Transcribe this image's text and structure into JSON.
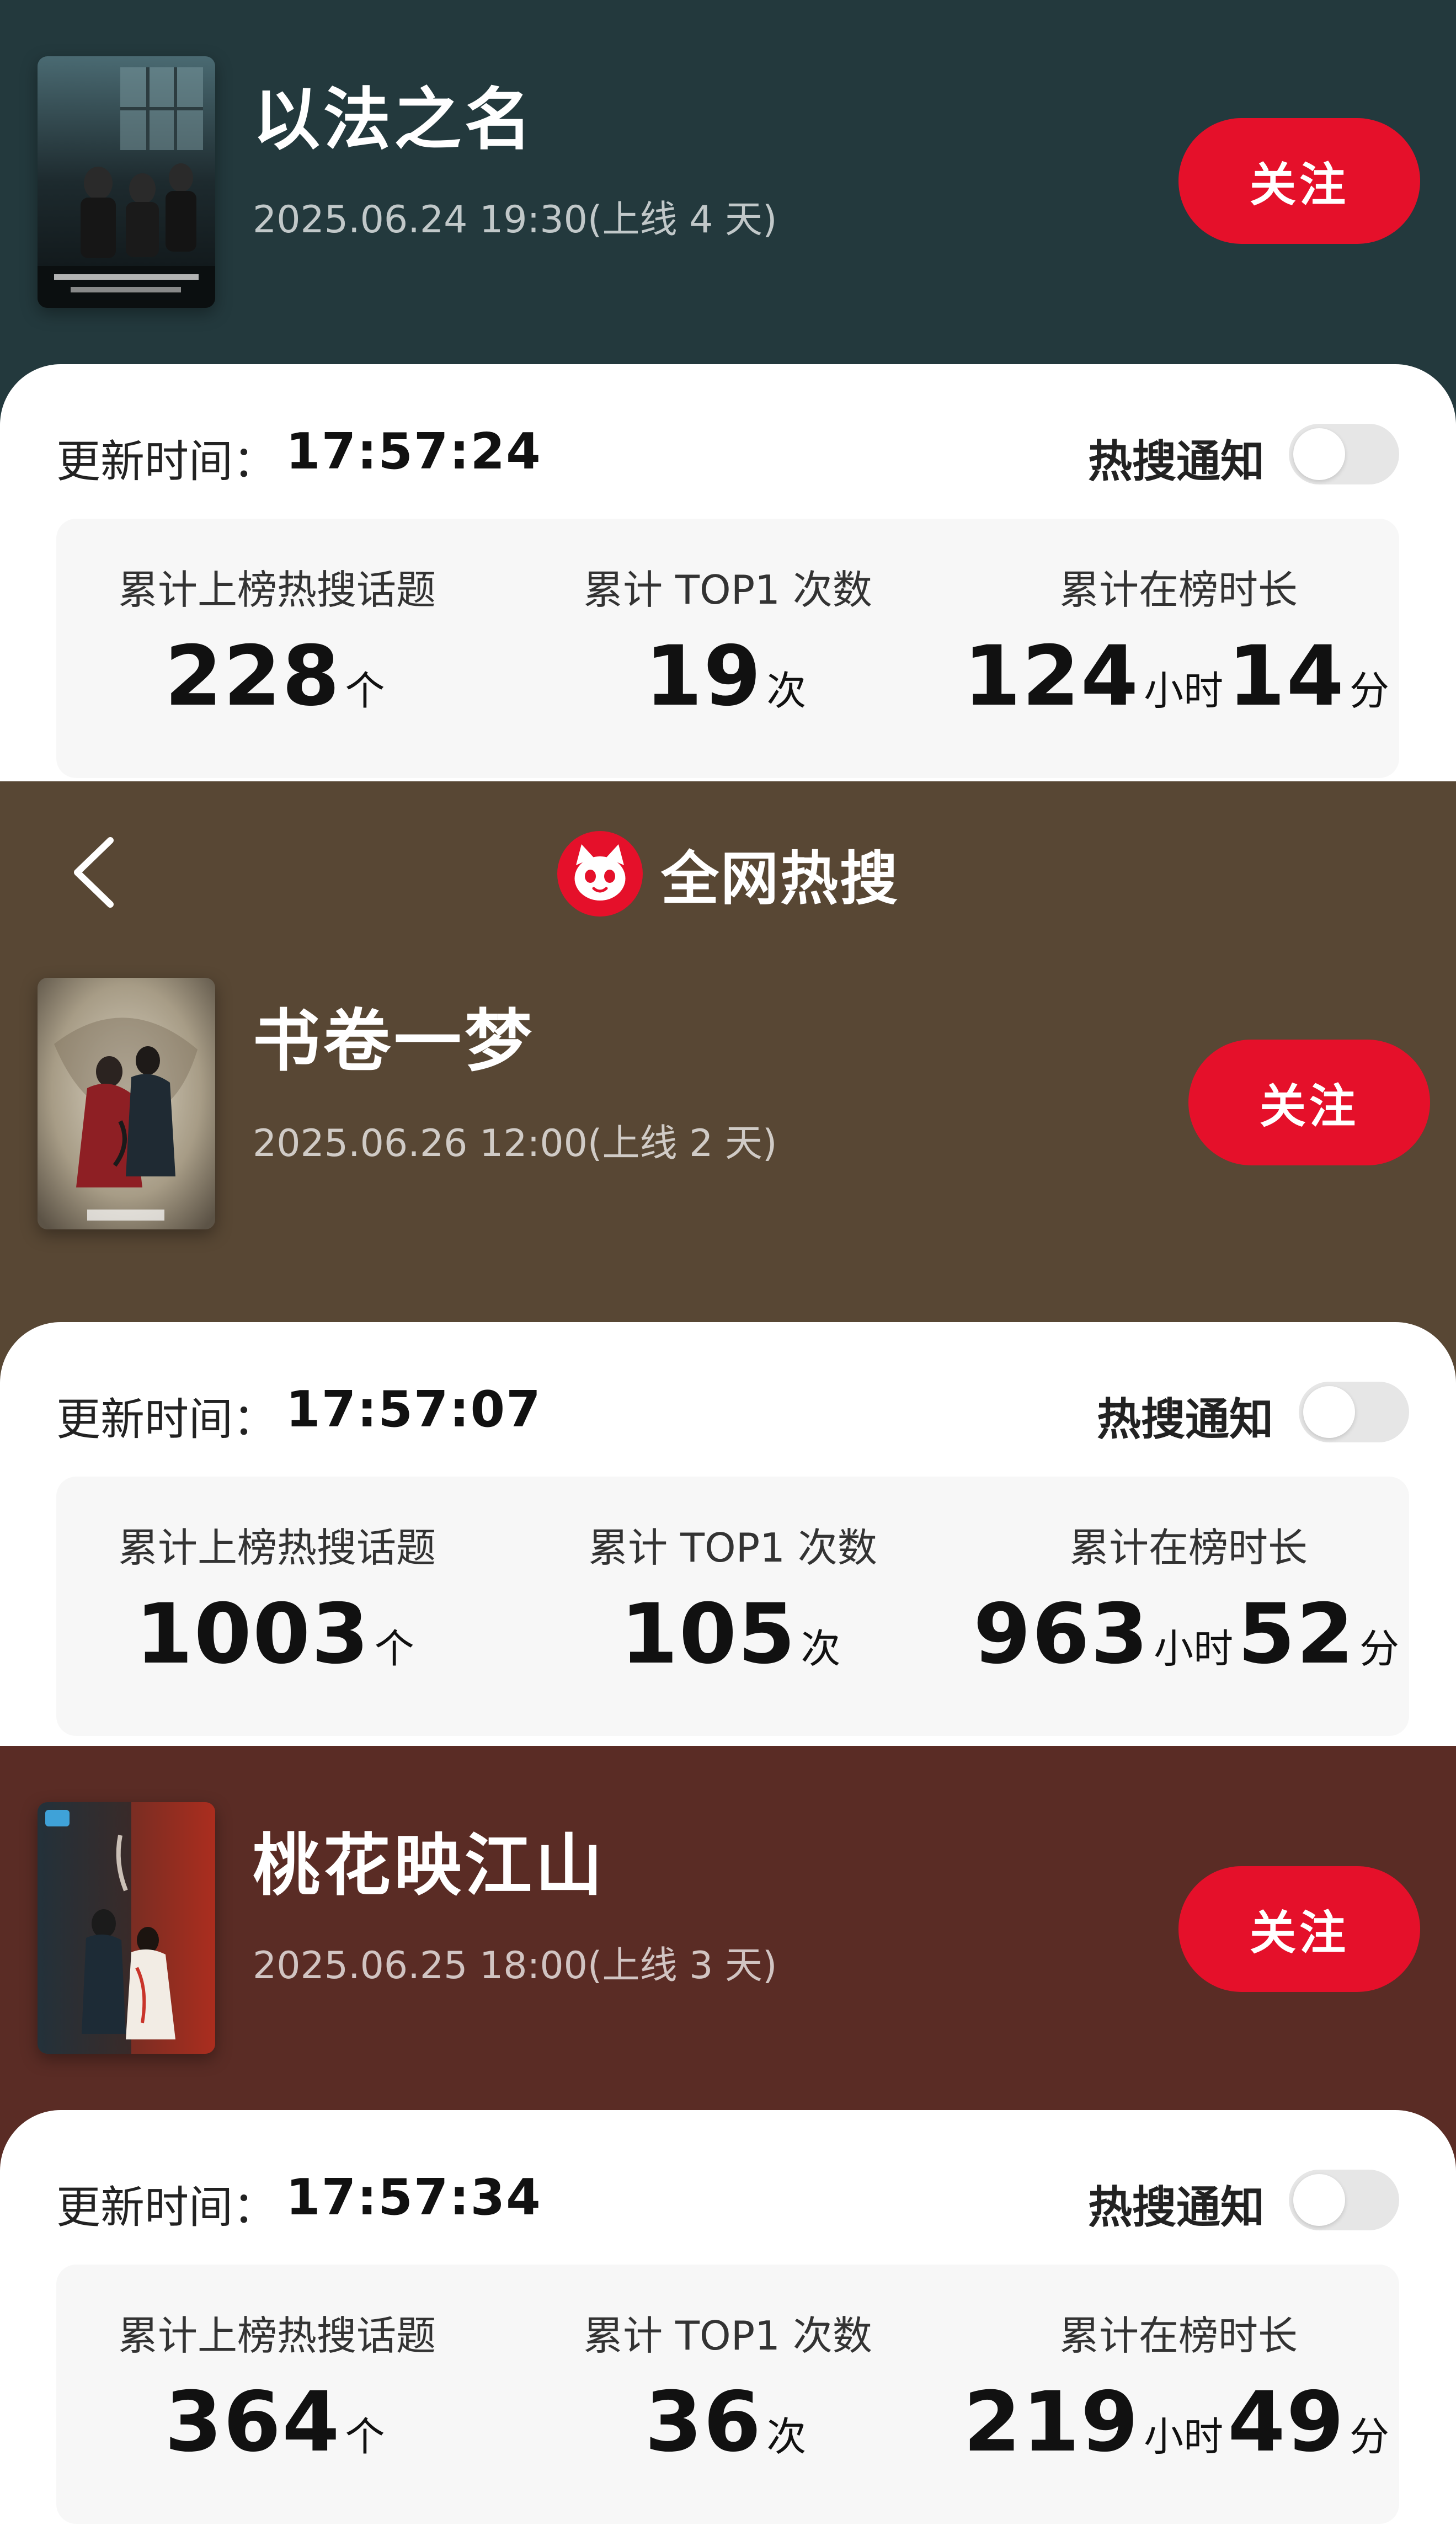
{
  "nav": {
    "title": "全网热搜",
    "back_icon": "chevron-left-icon",
    "logo_icon": "cat-logo-icon"
  },
  "colors": {
    "show1_bg": "#23393d",
    "show2_bg": "#584734",
    "show3_bg": "#5a2c25",
    "follow_button": "#e5102a"
  },
  "labels": {
    "update_prefix": "更新时间：",
    "notify": "热搜通知",
    "follow": "关注",
    "stat_topics": "累计上榜热搜话题",
    "stat_top1": "累计 TOP1 次数",
    "stat_duration": "累计在榜时长",
    "unit_count": "个",
    "unit_times": "次",
    "unit_hour": "小时",
    "unit_minute": "分"
  },
  "shows": [
    {
      "title": "以法之名",
      "date": "2025.06.24 19:30(上线 4 天)",
      "update_time": "17:57:24",
      "notify_on": false,
      "topics": "228",
      "top1": "19",
      "hours": "124",
      "minutes": "14"
    },
    {
      "title": "书卷一梦",
      "date": "2025.06.26 12:00(上线 2 天)",
      "update_time": "17:57:07",
      "notify_on": false,
      "topics": "1003",
      "top1": "105",
      "hours": "963",
      "minutes": "52"
    },
    {
      "title": "桃花映江山",
      "date": "2025.06.25 18:00(上线 3 天)",
      "update_time": "17:57:34",
      "notify_on": false,
      "topics": "364",
      "top1": "36",
      "hours": "219",
      "minutes": "49"
    }
  ]
}
